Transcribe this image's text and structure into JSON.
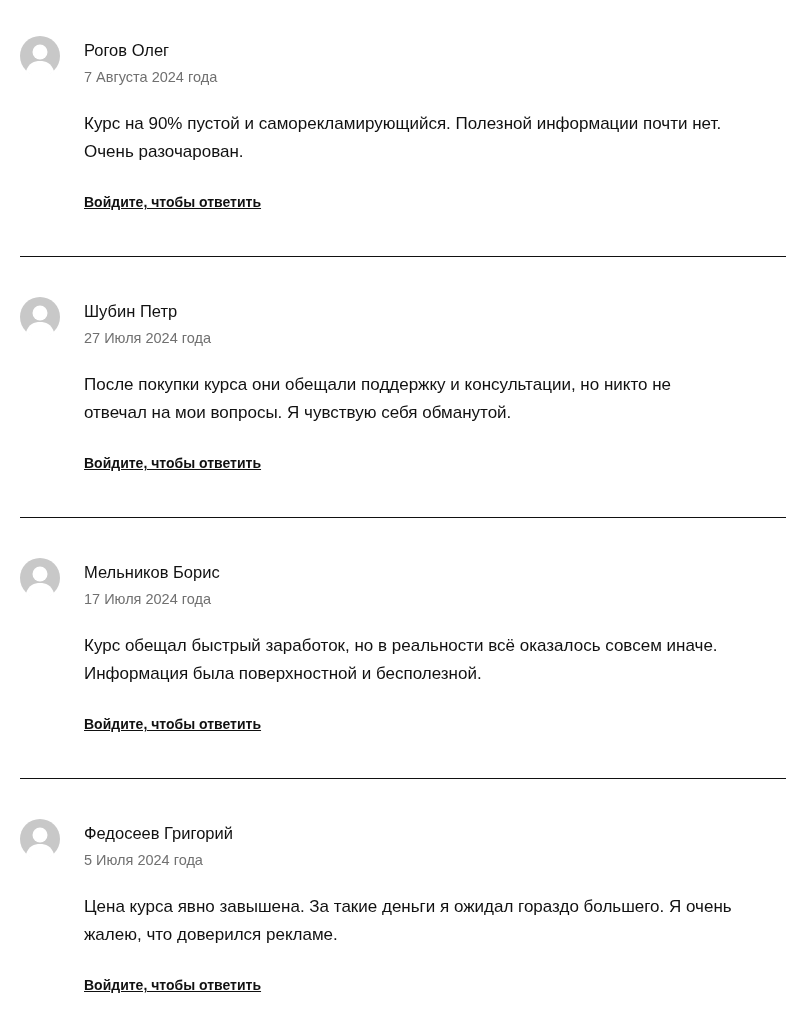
{
  "comments": [
    {
      "author": "Рогов Олег",
      "date": "7 Августа 2024 года",
      "text": "Курс на 90% пустой и саморекламирующийся. Полезной информации почти нет. Очень разочарован.",
      "reply_link": "Войдите, чтобы ответить"
    },
    {
      "author": "Шубин Петр",
      "date": "27 Июля 2024 года",
      "text": "После покупки курса они обещали поддержку и консультации, но никто не отвечал на мои вопросы. Я чувствую себя обманутой.",
      "reply_link": "Войдите, чтобы ответить"
    },
    {
      "author": "Мельников Борис",
      "date": "17 Июля 2024 года",
      "text": "Курс обещал быстрый заработок, но в реальности всё оказалось совсем иначе. Информация была поверхностной и бесполезной.",
      "reply_link": "Войдите, чтобы ответить"
    },
    {
      "author": "Федосеев Григорий",
      "date": "5 Июля 2024 года",
      "text": "Цена курса явно завышена. За такие деньги я ожидал гораздо большего. Я очень жалею, что доверился рекламе.",
      "reply_link": "Войдите, чтобы ответить"
    }
  ]
}
